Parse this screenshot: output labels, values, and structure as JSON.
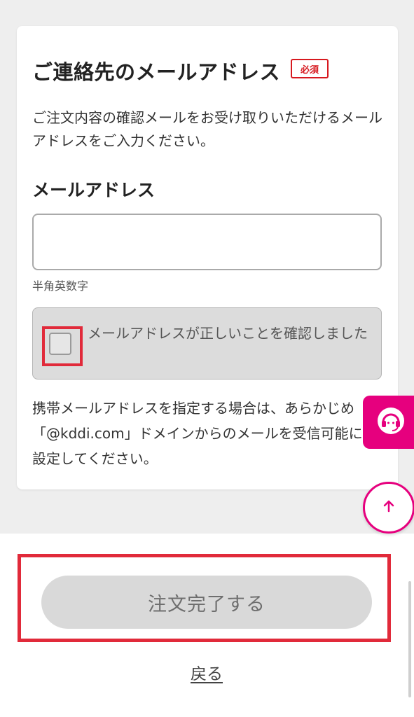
{
  "section": {
    "title": "ご連絡先のメールアドレス",
    "required_badge": "必須",
    "description": "ご注文内容の確認メールをお受け取りいただけるメールアドレスをご入力ください。"
  },
  "email": {
    "label": "メールアドレス",
    "value": "",
    "placeholder": "",
    "hint": "半角英数字"
  },
  "confirm": {
    "checked": false,
    "label": "メールアドレスが正しいことを確認しました"
  },
  "note": {
    "line1": "携帯メールアドレスを指定する場合は、あらかじめ",
    "line2": "「@kddi.com」ドメインからのメールを受信可能に",
    "line3": "設定してください。"
  },
  "floating": {
    "support_icon": "headset-icon",
    "top_icon": "arrow-up-icon",
    "accent_color": "#e6007e"
  },
  "footer": {
    "order_button": "注文完了する",
    "back_link": "戻る"
  },
  "colors": {
    "highlight": "#e12a3a",
    "required": "#d7191f"
  }
}
